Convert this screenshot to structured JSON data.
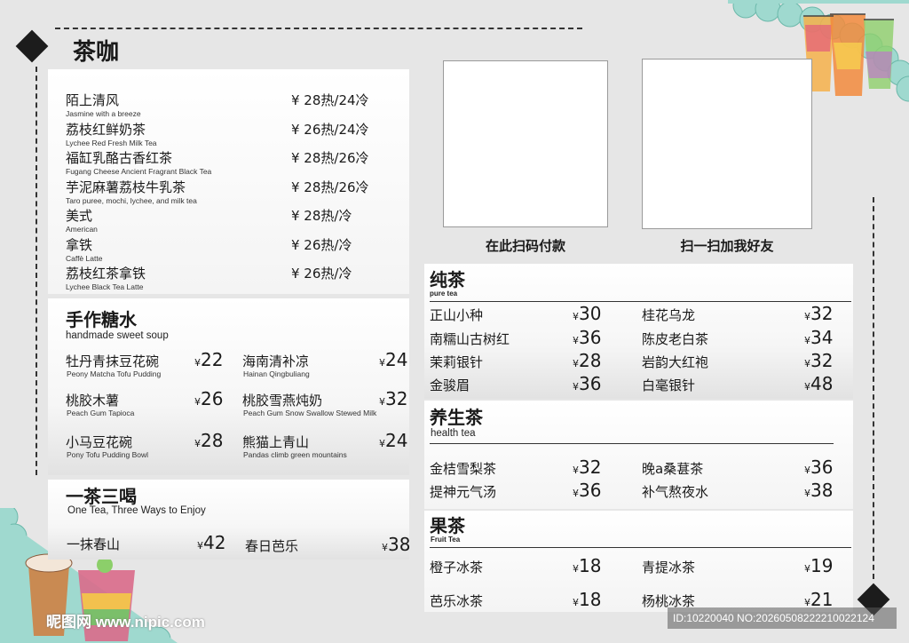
{
  "title": "茶咖",
  "tea_coffee": [
    {
      "name": "陌上清风",
      "en": "Jasmine with a breeze",
      "price": "¥ 28热/24冷"
    },
    {
      "name": "荔枝红鲜奶茶",
      "en": "Lychee Red Fresh Milk Tea",
      "price": "¥ 26热/24冷"
    },
    {
      "name": "福缸乳酪古香红茶",
      "en": "Fugang Cheese Ancient Fragrant Black Tea",
      "price": "¥ 28热/26冷"
    },
    {
      "name": "芋泥麻薯荔枝牛乳茶",
      "en": "Taro puree, mochi, lychee, and milk tea",
      "price": "¥ 28热/26冷"
    },
    {
      "name": "美式",
      "en": "American",
      "price": "¥ 28热/冷"
    },
    {
      "name": "拿铁",
      "en": "Caffè Latte",
      "price": "¥ 26热/冷"
    },
    {
      "name": "荔枝红茶拿铁",
      "en": "Lychee Black Tea Latte",
      "price": "¥ 26热/冷"
    }
  ],
  "soup": {
    "title": "手作糖水",
    "subtitle": "handmade sweet soup",
    "items": [
      {
        "name": "牡丹青抹豆花碗",
        "en": "Peony Matcha Tofu Pudding",
        "cur": "¥",
        "price": "22"
      },
      {
        "name": "海南清补凉",
        "en": "Hainan Qingbuliang",
        "cur": "¥",
        "price": "24"
      },
      {
        "name": "桃胶木薯",
        "en": "Peach Gum Tapioca",
        "cur": "¥",
        "price": "26"
      },
      {
        "name": "桃胶雪燕炖奶",
        "en": "Peach Gum Snow Swallow Stewed Milk",
        "cur": "¥",
        "price": "32"
      },
      {
        "name": "小马豆花碗",
        "en": "Pony Tofu Pudding Bowl",
        "cur": "¥",
        "price": "28"
      },
      {
        "name": "熊猫上青山",
        "en": "Pandas climb green mountains",
        "cur": "¥",
        "price": "24"
      }
    ]
  },
  "one_tea": {
    "title": "一茶三喝",
    "subtitle": "One Tea, Three Ways to Enjoy",
    "items": [
      {
        "name": "一抹春山",
        "cur": "¥",
        "price": "42"
      },
      {
        "name": "春日芭乐",
        "cur": "¥",
        "price": "38"
      }
    ]
  },
  "qr": {
    "pay_label": "在此扫码付款",
    "friend_label": "扫一扫加我好友"
  },
  "pure_tea": {
    "title": "纯茶",
    "subtitle": "pure tea",
    "items": [
      {
        "name": "正山小种",
        "cur": "¥",
        "price": "30"
      },
      {
        "name": "桂花乌龙",
        "cur": "¥",
        "price": "32"
      },
      {
        "name": "南糯山古树红",
        "cur": "¥",
        "price": "36"
      },
      {
        "name": "陈皮老白茶",
        "cur": "¥",
        "price": "34"
      },
      {
        "name": "茉莉银针",
        "cur": "¥",
        "price": "28"
      },
      {
        "name": "岩韵大红袍",
        "cur": "¥",
        "price": "32"
      },
      {
        "name": "金骏眉",
        "cur": "¥",
        "price": "36"
      },
      {
        "name": "白毫银针",
        "cur": "¥",
        "price": "48"
      }
    ]
  },
  "health_tea": {
    "title": "养生茶",
    "subtitle": "health tea",
    "items": [
      {
        "name": "金桔雪梨茶",
        "cur": "¥",
        "price": "32"
      },
      {
        "name": "晚a桑葚茶",
        "cur": "¥",
        "price": "36"
      },
      {
        "name": "提神元气汤",
        "cur": "¥",
        "price": "36"
      },
      {
        "name": "补气熬夜水",
        "cur": "¥",
        "price": "38"
      }
    ]
  },
  "fruit_tea": {
    "title": "果茶",
    "subtitle": "Fruit Tea",
    "items": [
      {
        "name": "橙子冰茶",
        "cur": "¥",
        "price": "18"
      },
      {
        "name": "青提冰茶",
        "cur": "¥",
        "price": "19"
      },
      {
        "name": "芭乐冰茶",
        "cur": "¥",
        "price": "18"
      },
      {
        "name": "杨桃冰茶",
        "cur": "¥",
        "price": "21"
      }
    ]
  },
  "watermark": {
    "logo": "昵图网 www.nipic.com",
    "id": "ID:10220040 NO:20260508222210022124"
  },
  "colors": {
    "background": "#e6e6e6",
    "scallop": "#9fd9cf",
    "ink": "#1a1a1a"
  }
}
